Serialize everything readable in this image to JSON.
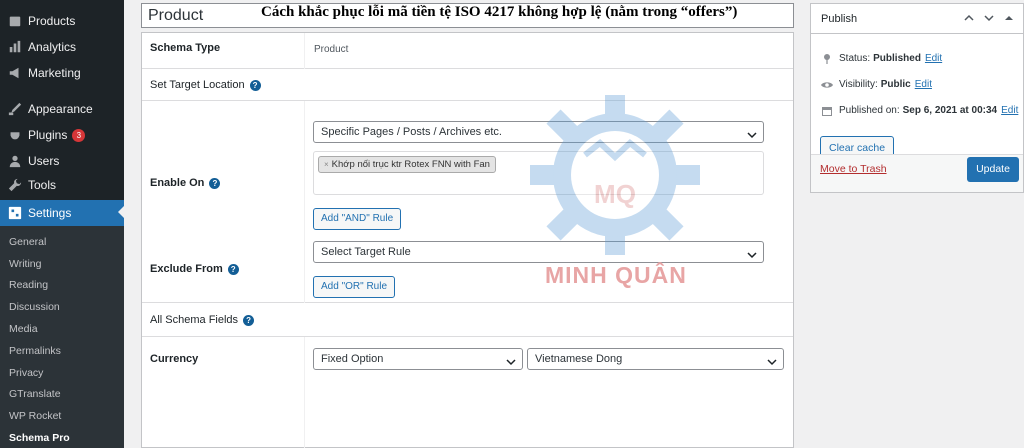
{
  "sidebar": {
    "items": [
      {
        "label": "Products",
        "icon": "products-icon"
      },
      {
        "label": "Analytics",
        "icon": "analytics-icon"
      },
      {
        "label": "Marketing",
        "icon": "marketing-icon"
      },
      {
        "label": "Appearance",
        "icon": "appearance-icon"
      },
      {
        "label": "Plugins",
        "icon": "plugins-icon",
        "badge": "3"
      },
      {
        "label": "Users",
        "icon": "users-icon"
      },
      {
        "label": "Tools",
        "icon": "tools-icon"
      },
      {
        "label": "Settings",
        "icon": "settings-icon",
        "active": true
      }
    ],
    "subitems": [
      "General",
      "Writing",
      "Reading",
      "Discussion",
      "Media",
      "Permalinks",
      "Privacy",
      "GTranslate",
      "WP Rocket",
      "Schema Pro"
    ]
  },
  "title": {
    "value": "Product",
    "overlay": "Cách khắc phục lỗi mã tiền tệ ISO 4217 không hợp lệ (nằm trong “offers”)"
  },
  "schema": {
    "type_label": "Schema Type",
    "type_value": "Product",
    "target_location": "Set Target Location",
    "enable_on_label": "Enable On",
    "enable_on_select": "Specific Pages / Posts / Archives etc.",
    "enable_on_tag": "Khớp nối trục ktr Rotex FNN with Fan",
    "add_and_rule": "Add \"AND\" Rule",
    "exclude_from_label": "Exclude From",
    "exclude_select": "Select Target Rule",
    "add_or_rule": "Add \"OR\" Rule",
    "all_fields": "All Schema Fields",
    "currency_label": "Currency",
    "currency_option": "Fixed Option",
    "currency_value": "Vietnamese Dong"
  },
  "watermark": {
    "letters": "MQ",
    "text": "MINH QUÂN"
  },
  "publish": {
    "title": "Publish",
    "status_label": "Status:",
    "status_value": "Published",
    "visibility_label": "Visibility:",
    "visibility_value": "Public",
    "published_label": "Published on:",
    "published_value": "Sep 6, 2021 at 00:34",
    "edit": "Edit",
    "clear_cache": "Clear cache",
    "trash": "Move to Trash",
    "update": "Update"
  },
  "colors": {
    "sidebar_bg": "#1d2327",
    "accent": "#2271b1",
    "badge": "#d63638"
  }
}
